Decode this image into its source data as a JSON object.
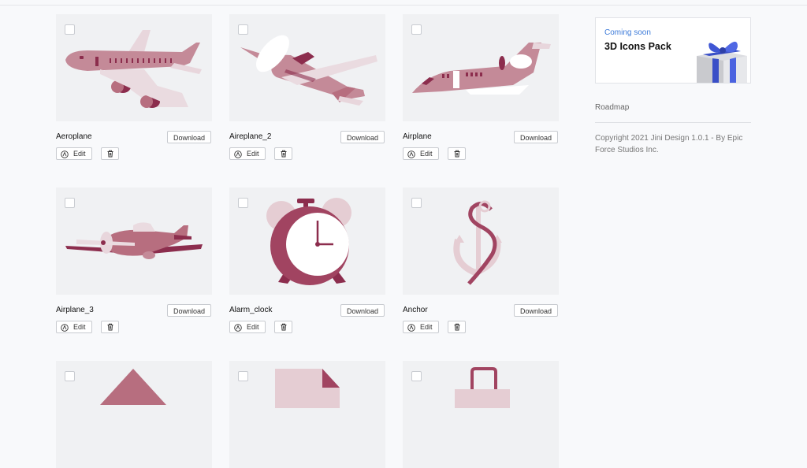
{
  "colors": {
    "primary": "#b76e7f",
    "light": "#e9d3d9",
    "dark": "#8c2d4d",
    "thumb_bg": "#f0f1f3",
    "accent": "#3d7bd9"
  },
  "buttons": {
    "download": "Download",
    "edit": "Edit"
  },
  "icons": [
    {
      "name": "Aeroplane",
      "art": "aeroplane"
    },
    {
      "name": "Aireplane_2",
      "art": "aireplane-2"
    },
    {
      "name": "Airplane",
      "art": "airplane"
    },
    {
      "name": "Airplane_3",
      "art": "airplane-3"
    },
    {
      "name": "Alarm_clock",
      "art": "alarm-clock"
    },
    {
      "name": "Anchor",
      "art": "anchor"
    },
    {
      "name": "",
      "art": "pyramid"
    },
    {
      "name": "",
      "art": "document"
    },
    {
      "name": "",
      "art": "shopping-bag"
    }
  ],
  "sidebar": {
    "promo_kicker": "Coming soon",
    "promo_title": "3D Icons Pack",
    "promo_art": "gift-box",
    "roadmap": "Roadmap",
    "copyright": "Copyright 2021 Jini Design 1.0.1 - By Epic Force Studios Inc."
  }
}
